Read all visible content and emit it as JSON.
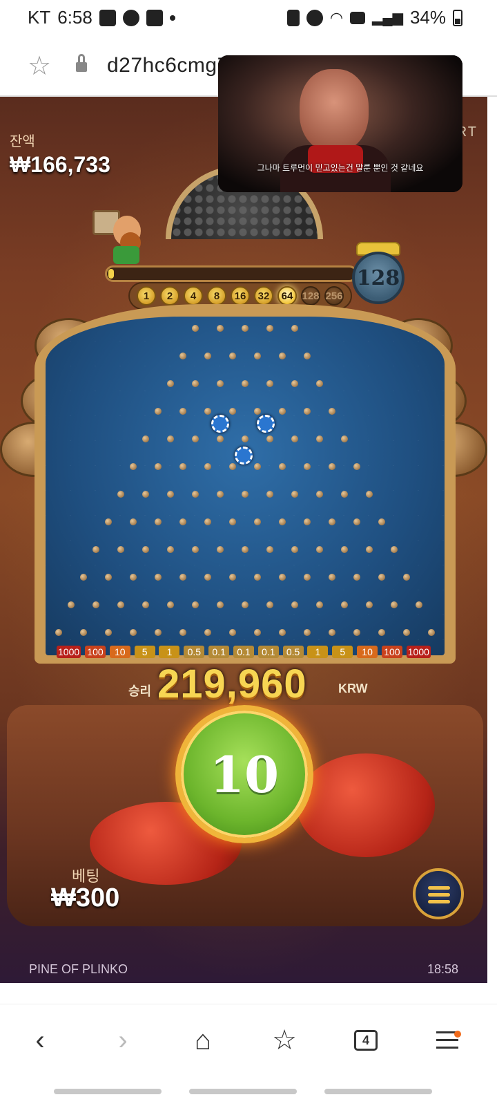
{
  "status_bar": {
    "carrier": "KT",
    "time": "6:58",
    "battery": "34%",
    "icons": [
      "gallery-icon",
      "weather-icon",
      "webtoon-icon",
      "dot-icon",
      "lock-icon",
      "alarm-icon",
      "wifi-icon",
      "hd-icon",
      "signal-icon",
      "battery-icon"
    ]
  },
  "browser": {
    "url": "d27hc6cmg7"
  },
  "game": {
    "balance_label": "잔액",
    "balance_value": "₩166,733",
    "side_label": "RT",
    "level_counter": "128",
    "progress": 0.01,
    "levels": [
      {
        "label": "1",
        "state": "on"
      },
      {
        "label": "2",
        "state": "on"
      },
      {
        "label": "4",
        "state": "on"
      },
      {
        "label": "8",
        "state": "on"
      },
      {
        "label": "16",
        "state": "on"
      },
      {
        "label": "32",
        "state": "on"
      },
      {
        "label": "64",
        "state": "active"
      },
      {
        "label": "128",
        "state": "locked"
      },
      {
        "label": "256",
        "state": "locked"
      }
    ],
    "multipliers": [
      "1000",
      "100",
      "10",
      "5",
      "1",
      "0.5",
      "0.1",
      "0.1",
      "0.1",
      "0.5",
      "1",
      "5",
      "10",
      "100",
      "1000"
    ],
    "win_label": "승리",
    "win_value": "219,960",
    "win_currency": "KRW",
    "play_count": "10",
    "bet_label": "베팅",
    "bet_value": "₩300",
    "game_name": "PINE OF PLINKO",
    "clock": "18:58"
  },
  "video": {
    "subtitle": "그나마 트루먼이 믿고있는건 말룬 뿐인 것 같네요"
  },
  "navbar": {
    "tab_count": "4"
  }
}
